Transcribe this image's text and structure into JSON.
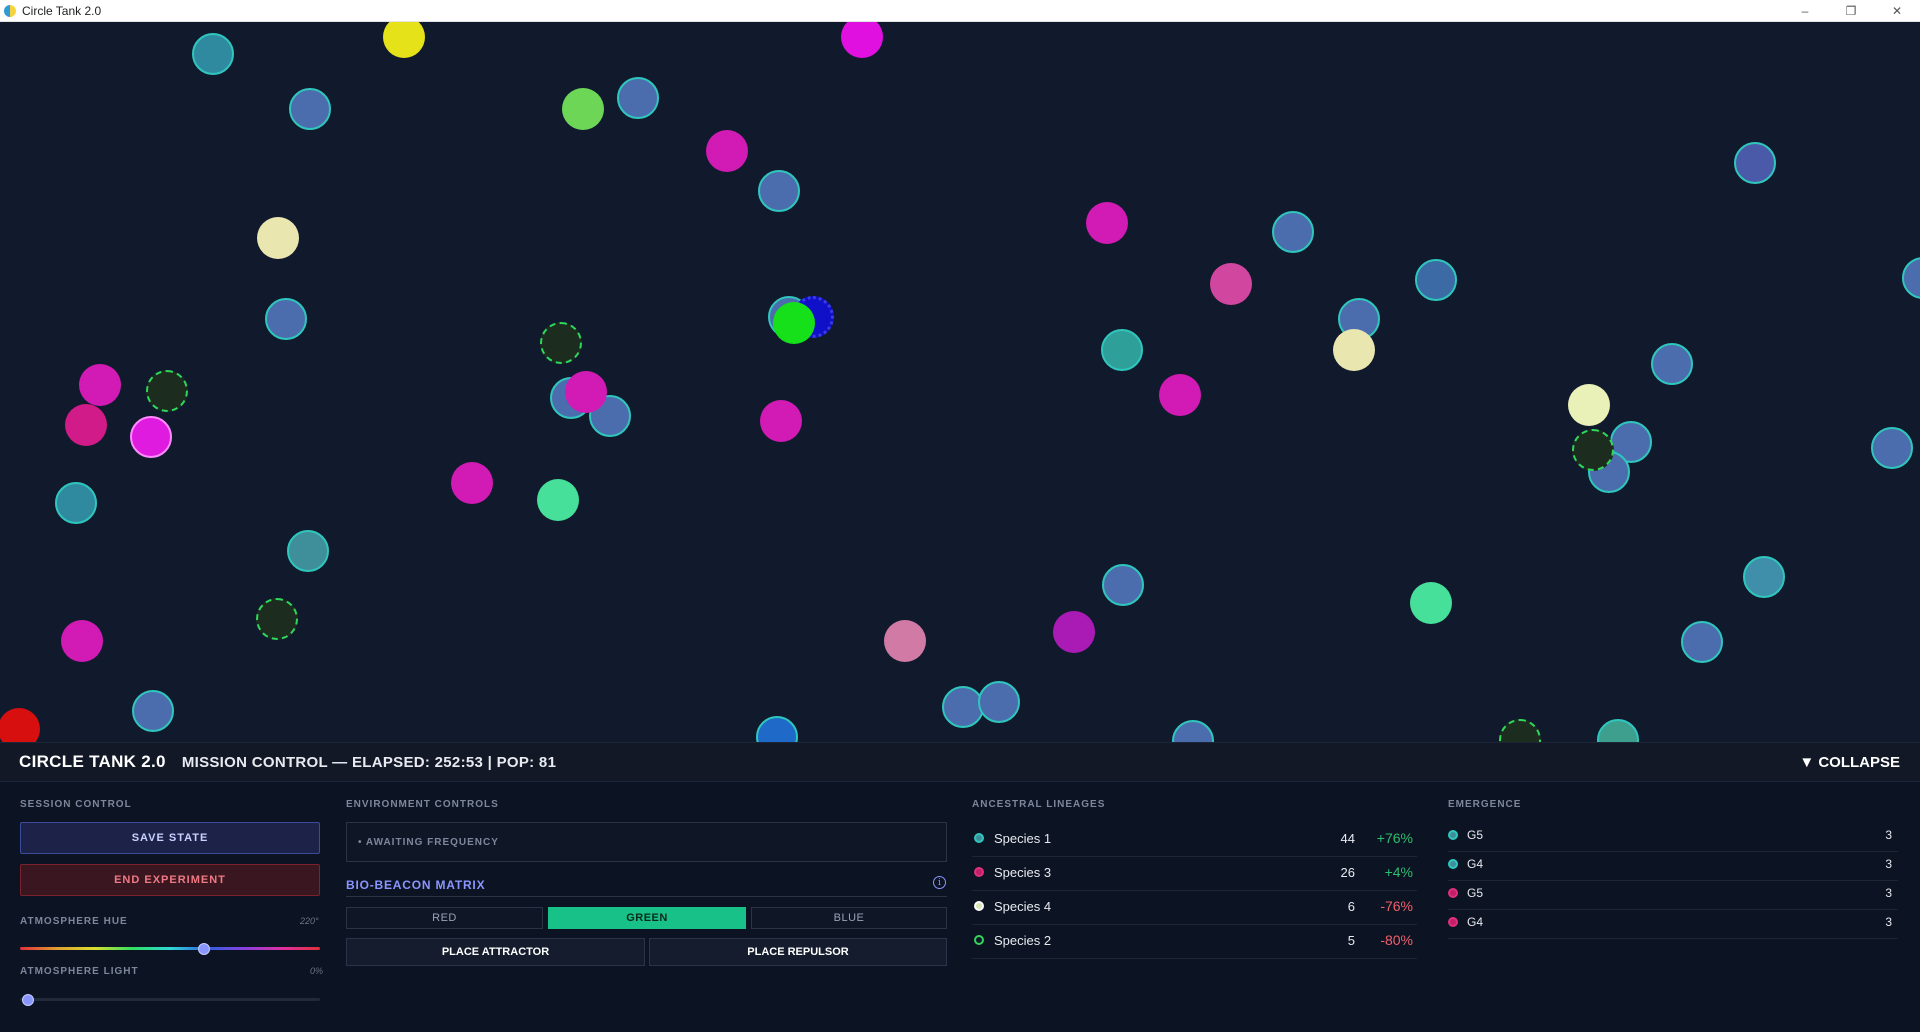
{
  "window": {
    "title": "Circle Tank 2.0",
    "controls": {
      "minimize": "–",
      "restore": "❐",
      "close": "✕"
    }
  },
  "header": {
    "brand": "CIRCLE TANK 2.0",
    "mission": "MISSION CONTROL — ELAPSED: 252:53 | POP: 81",
    "collapse": "▼ COLLAPSE"
  },
  "session": {
    "title": "SESSION CONTROL",
    "save_label": "SAVE STATE",
    "end_label": "END EXPERIMENT",
    "hue": {
      "label": "ATMOSPHERE HUE",
      "value_text": "220°",
      "value": 220,
      "max": 360
    },
    "light": {
      "label": "ATMOSPHERE LIGHT",
      "value_text": "0%",
      "value": 0
    }
  },
  "environment": {
    "title": "ENVIRONMENT CONTROLS",
    "status": "• AWAITING FREQUENCY",
    "matrix_title": "BIO-BEACON MATRIX",
    "info_icon": "i",
    "colors": [
      {
        "label": "RED",
        "active": false
      },
      {
        "label": "GREEN",
        "active": true
      },
      {
        "label": "BLUE",
        "active": false
      }
    ],
    "attractor_label": "PLACE ATTRACTOR",
    "repulsor_label": "PLACE REPULSOR"
  },
  "lineages": {
    "title": "ANCESTRAL LINEAGES",
    "rows": [
      {
        "name": "Species 1",
        "count": "44",
        "change": "+76%",
        "color": "#2fc7bd",
        "fill": "#3f8f9a",
        "positive": true
      },
      {
        "name": "Species 3",
        "count": "26",
        "change": "+4%",
        "color": "#e0307f",
        "fill": "#c21f6a",
        "positive": true
      },
      {
        "name": "Species 4",
        "count": "6",
        "change": "-76%",
        "color": "#ffffff",
        "fill": "#d9e8b0",
        "positive": false
      },
      {
        "name": "Species 2",
        "count": "5",
        "change": "-80%",
        "color": "#32d55a",
        "fill": "#0f1627",
        "positive": false
      }
    ]
  },
  "emergence": {
    "title": "EMERGENCE",
    "rows": [
      {
        "name": "G5",
        "count": "3",
        "color": "#2fc7bd",
        "fill": "#3f8f9a"
      },
      {
        "name": "G4",
        "count": "3",
        "color": "#2fc7bd",
        "fill": "#3f8f9a"
      },
      {
        "name": "G5",
        "count": "3",
        "color": "#e0307f",
        "fill": "#c21f6a"
      },
      {
        "name": "G4",
        "count": "3",
        "color": "#e0307f",
        "fill": "#c21f6a"
      }
    ]
  },
  "colors": {
    "positive": "#2dbd6e",
    "negative": "#f0606c",
    "accent": "#8a96ff",
    "active_green": "#18c187"
  }
}
